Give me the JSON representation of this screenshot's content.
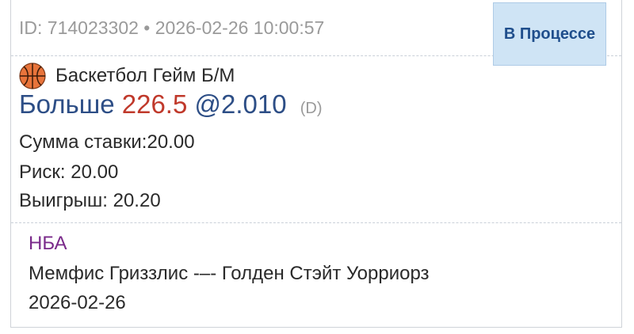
{
  "header": {
    "id_label": "ID: 714023302",
    "separator": "•",
    "datetime": "2026-02-26 10:00:57",
    "status": "В Процессе"
  },
  "bet": {
    "sport_icon": "basketball-icon",
    "market": "Баскетбол Гейм Б/М",
    "selection": "Больше",
    "line": "226.5",
    "odds": "@2.010",
    "odds_type": "(D)",
    "stake_label": "Сумма ставки:",
    "stake_value": "20.00",
    "risk_label": "Риск:",
    "risk_value": "20.00",
    "win_label": "Выигрыш:",
    "win_value": "20.20"
  },
  "event": {
    "league": "НБА",
    "match": "Мемфис Гриззлис -–- Голден Стэйт Уорриорз",
    "date": "2026-02-26"
  },
  "colors": {
    "accent": "#2d4e86",
    "line": "#c0392b",
    "league": "#7a2a8a",
    "status_bg": "#cfe4f5"
  }
}
